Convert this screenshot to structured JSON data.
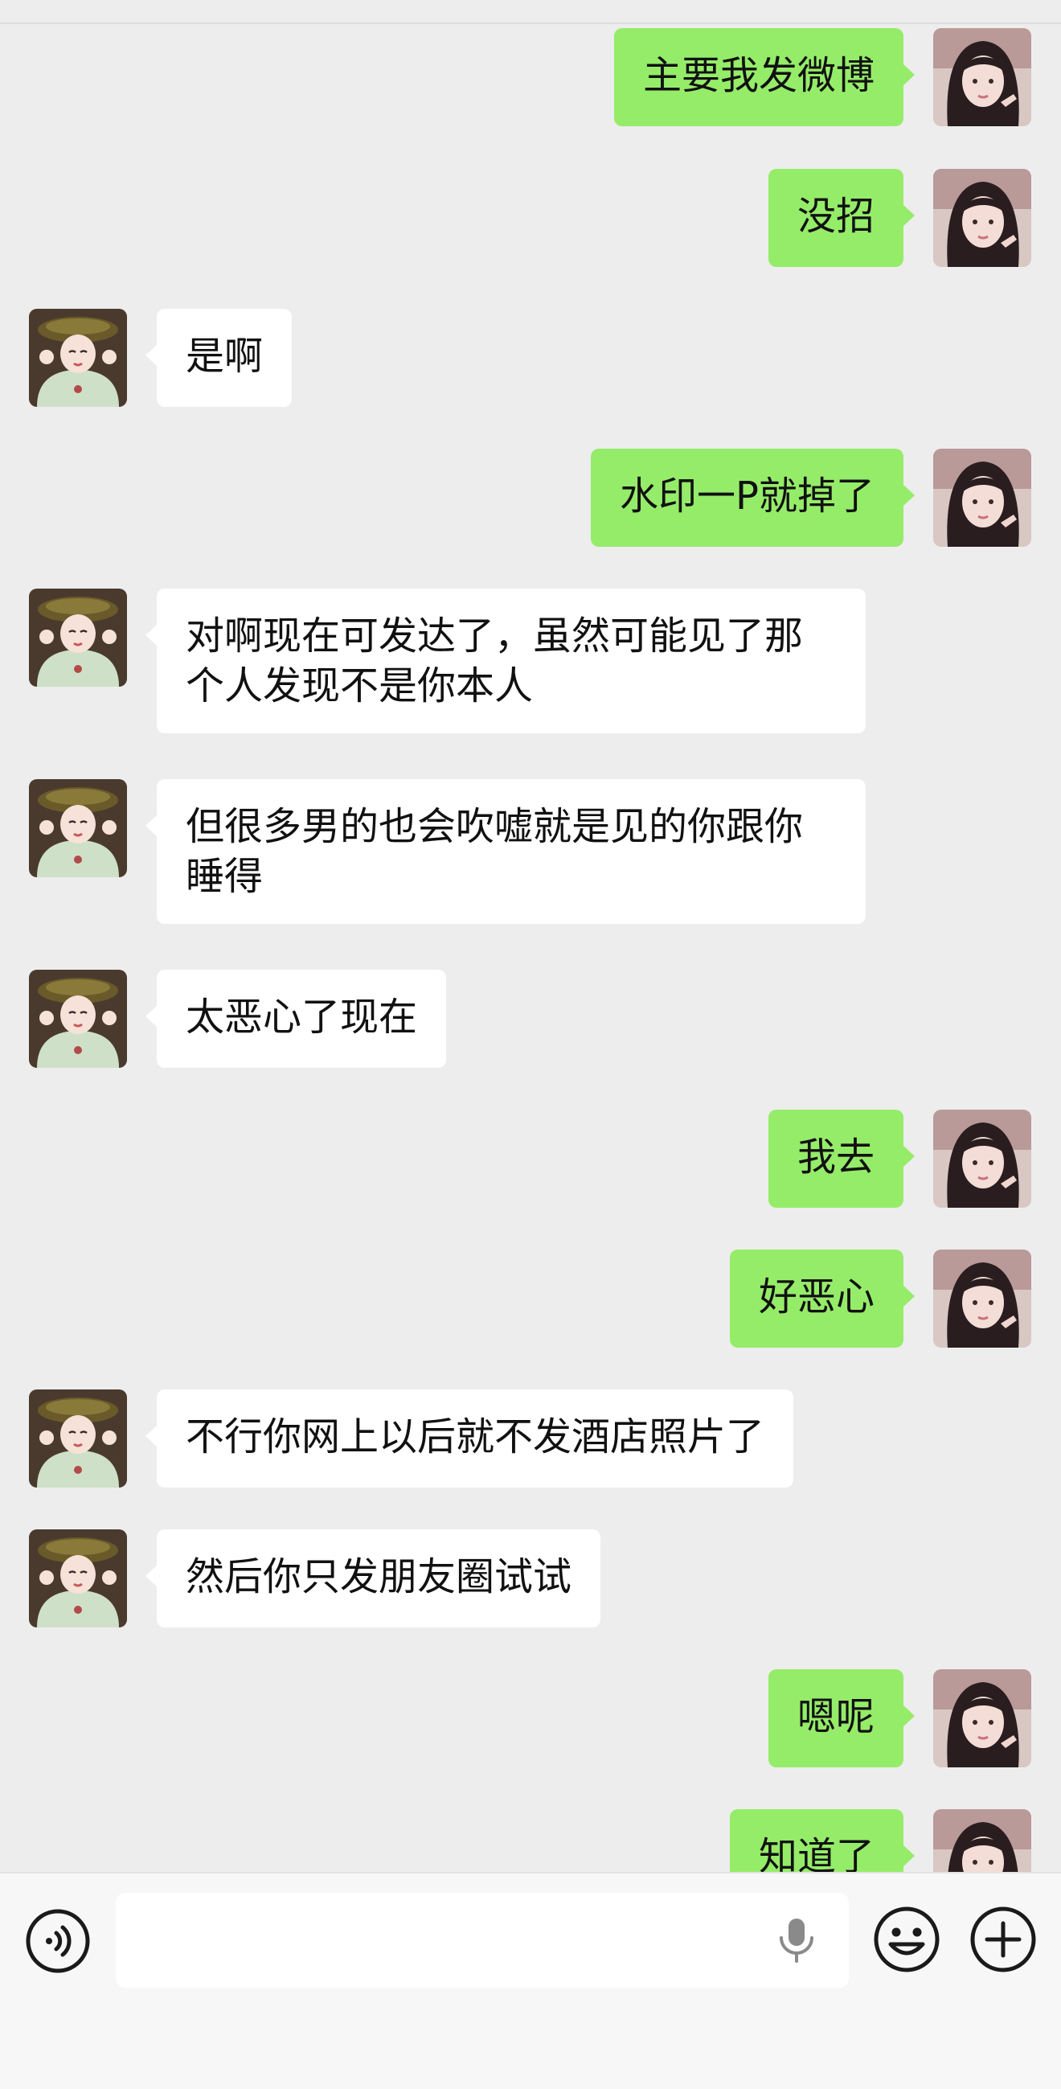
{
  "messages": [
    {
      "sender": "me",
      "text": "主要我发微博"
    },
    {
      "sender": "me",
      "text": "没招"
    },
    {
      "sender": "them",
      "text": "是啊"
    },
    {
      "sender": "me",
      "text": "水印一P就掉了"
    },
    {
      "sender": "them",
      "text": "对啊现在可发达了，虽然可能见了那个人发现不是你本人"
    },
    {
      "sender": "them",
      "text": "但很多男的也会吹嘘就是见的你跟你睡得"
    },
    {
      "sender": "them",
      "text": "太恶心了现在"
    },
    {
      "sender": "me",
      "text": "我去"
    },
    {
      "sender": "me",
      "text": "好恶心"
    },
    {
      "sender": "them",
      "text": "不行你网上以后就不发酒店照片了"
    },
    {
      "sender": "them",
      "text": "然后你只发朋友圈试试"
    },
    {
      "sender": "me",
      "text": "嗯呢"
    },
    {
      "sender": "me",
      "text": "知道了"
    }
  ],
  "input": {
    "value": ""
  },
  "icons": {
    "voice": "voice-input-icon",
    "mic": "microphone-icon",
    "emoji": "emoji-icon",
    "more": "plus-circle-icon"
  },
  "colors": {
    "background": "#ededed",
    "sent_bubble": "#95ec69",
    "received_bubble": "#ffffff",
    "bottom_bar": "#f7f7f7"
  }
}
